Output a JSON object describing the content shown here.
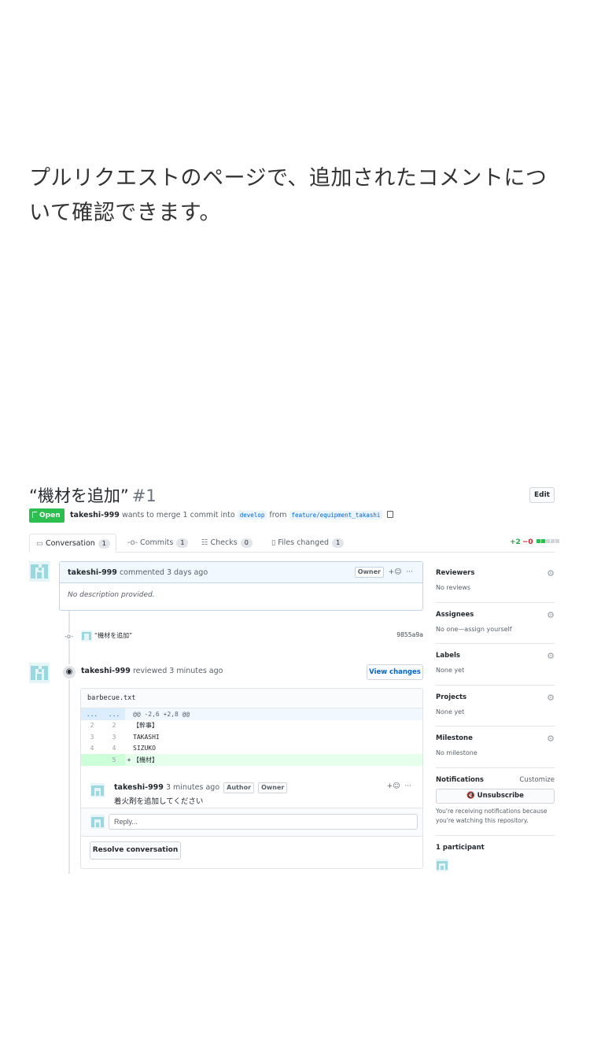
{
  "caption": "プルリクエストのページで、追加されたコメントについて確認できます。",
  "pr": {
    "title": "“機材を追加”",
    "number": "#1",
    "edit_label": "Edit",
    "status": "Open",
    "author": "takeshi-999",
    "merge_text": "wants to merge 1 commit into",
    "base_branch": "develop",
    "from_text": "from",
    "head_branch": "feature/equipment_takashi"
  },
  "tabs": [
    {
      "label": "Conversation",
      "count": "1",
      "icon": "comment-icon"
    },
    {
      "label": "Commits",
      "count": "1",
      "icon": "commit-icon"
    },
    {
      "label": "Checks",
      "count": "0",
      "icon": "checks-icon"
    },
    {
      "label": "Files changed",
      "count": "1",
      "icon": "file-diff-icon"
    }
  ],
  "diffstat": {
    "additions": "+2",
    "deletions": "−0"
  },
  "description_comment": {
    "author": "takeshi-999",
    "action": "commented 3 days ago",
    "label": "Owner",
    "reaction": "+☺",
    "more": "···",
    "body": "No description provided."
  },
  "commit": {
    "message": "“機材を追加”",
    "sha": "9855a9a"
  },
  "review": {
    "author": "takeshi-999",
    "action": "reviewed 3 minutes ago",
    "view_changes_label": "View changes",
    "file_name": "barbecue.txt",
    "hunk": {
      "old": "...",
      "new": "...",
      "text": "@@ -2,6 +2,8 @@"
    },
    "lines": [
      {
        "old": "2",
        "new": "2",
        "sign": "",
        "text": "【幹事】"
      },
      {
        "old": "3",
        "new": "3",
        "sign": "",
        "text": "TAKASHI"
      },
      {
        "old": "4",
        "new": "4",
        "sign": "",
        "text": "SIZUKO"
      },
      {
        "old": "",
        "new": "5",
        "sign": "+",
        "text": "【機材】"
      }
    ],
    "inline_comment": {
      "author": "takeshi-999",
      "time": "3 minutes ago",
      "labels": [
        "Author",
        "Owner"
      ],
      "reaction": "+☺",
      "more": "···",
      "body": "着火剤を追加してください"
    },
    "reply_placeholder": "Reply...",
    "resolve_label": "Resolve conversation"
  },
  "sidebar": {
    "reviewers": {
      "title": "Reviewers",
      "value": "No reviews"
    },
    "assignees": {
      "title": "Assignees",
      "value": "No one—assign yourself"
    },
    "labels": {
      "title": "Labels",
      "value": "None yet"
    },
    "projects": {
      "title": "Projects",
      "value": "None yet"
    },
    "milestone": {
      "title": "Milestone",
      "value": "No milestone"
    },
    "notifications": {
      "title": "Notifications",
      "customize": "Customize",
      "unsubscribe": "🔇 Unsubscribe",
      "text": "You're receiving notifications because you're watching this repository."
    },
    "participants": {
      "title": "1 participant"
    }
  },
  "colors": {
    "open_green": "#2cbe4e",
    "link_blue": "#0366d6",
    "addition_bg": "#e6ffed"
  }
}
